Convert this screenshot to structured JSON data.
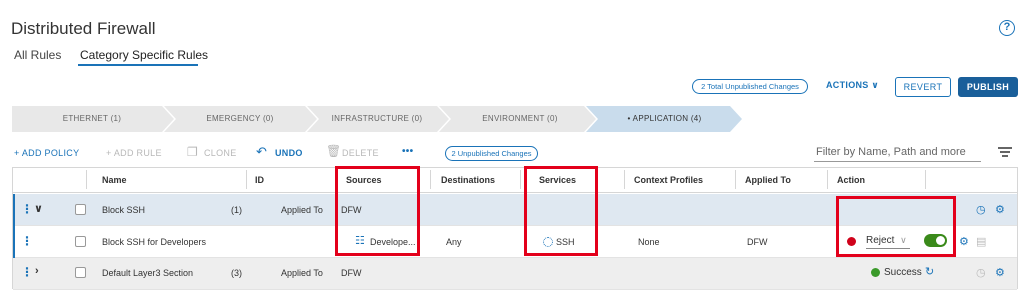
{
  "header": {
    "title": "Distributed Firewall",
    "help_icon": "help-icon",
    "tabs": [
      {
        "label": "All Rules",
        "active": false
      },
      {
        "label": "Category Specific Rules",
        "active": true
      }
    ]
  },
  "top_actions": {
    "unpublished_total": "2 Total Unpublished Changes",
    "actions_label": "ACTIONS ∨",
    "revert_label": "REVERT",
    "publish_label": "PUBLISH"
  },
  "categories": [
    {
      "label": "ETHERNET (1)",
      "active": false
    },
    {
      "label": "EMERGENCY (0)",
      "active": false
    },
    {
      "label": "INFRASTRUCTURE (0)",
      "active": false
    },
    {
      "label": "ENVIRONMENT (0)",
      "active": false
    },
    {
      "label": "• APPLICATION (4)",
      "active": true
    }
  ],
  "toolbar": {
    "add_policy": "+ ADD POLICY",
    "add_rule": "+ ADD RULE",
    "clone": "CLONE",
    "undo": "UNDO",
    "delete": "DELETE",
    "more": "•••",
    "unpublished_local": "2 Unpublished Changes",
    "filter_placeholder": "Filter by Name, Path and more"
  },
  "table": {
    "columns": [
      "Name",
      "ID",
      "Sources",
      "Destinations",
      "Services",
      "Context Profiles",
      "Applied To",
      "Action"
    ],
    "rows": [
      {
        "type": "policy",
        "expanded": true,
        "name": "Block SSH",
        "count": "(1)",
        "applied_to_label": "Applied To",
        "applied_to": "DFW"
      },
      {
        "type": "rule",
        "name": "Block SSH for Developers",
        "sources": "Develope...",
        "destinations": "Any",
        "services": "SSH",
        "context_profiles": "None",
        "applied_to": "DFW",
        "action": "Reject",
        "action_chevron": "∨",
        "action_color": "#d0021b",
        "enabled": true
      },
      {
        "type": "policy",
        "expanded": false,
        "name": "Default Layer3 Section",
        "count": "(3)",
        "applied_to_label": "Applied To",
        "applied_to": "DFW",
        "status": "Success",
        "status_color": "#3a9a2a"
      }
    ]
  },
  "colors": {
    "accent": "#1a73b8",
    "highlight": "#e3001b",
    "publish_bg": "#1a5f9a"
  }
}
